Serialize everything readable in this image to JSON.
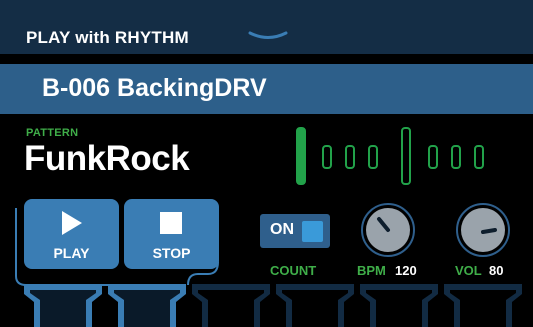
{
  "header": {
    "title": "PLAY with RHYTHM"
  },
  "patch": {
    "name": "B-006 BackingDRV"
  },
  "pattern": {
    "label": "PATTERN",
    "value": "FunkRock"
  },
  "beats": {
    "count": 8,
    "active_index": 0
  },
  "controls": {
    "play_label": "PLAY",
    "stop_label": "STOP"
  },
  "count": {
    "toggle_label": "ON",
    "toggle_on": true,
    "label": "COUNT"
  },
  "bpm": {
    "label": "BPM",
    "value": "120"
  },
  "vol": {
    "label": "VOL",
    "value": "80"
  },
  "colors": {
    "accent_green": "#22a24a",
    "button_blue": "#3a7db4",
    "header_bg": "#142d45",
    "patch_bg": "#2d5f8a"
  }
}
